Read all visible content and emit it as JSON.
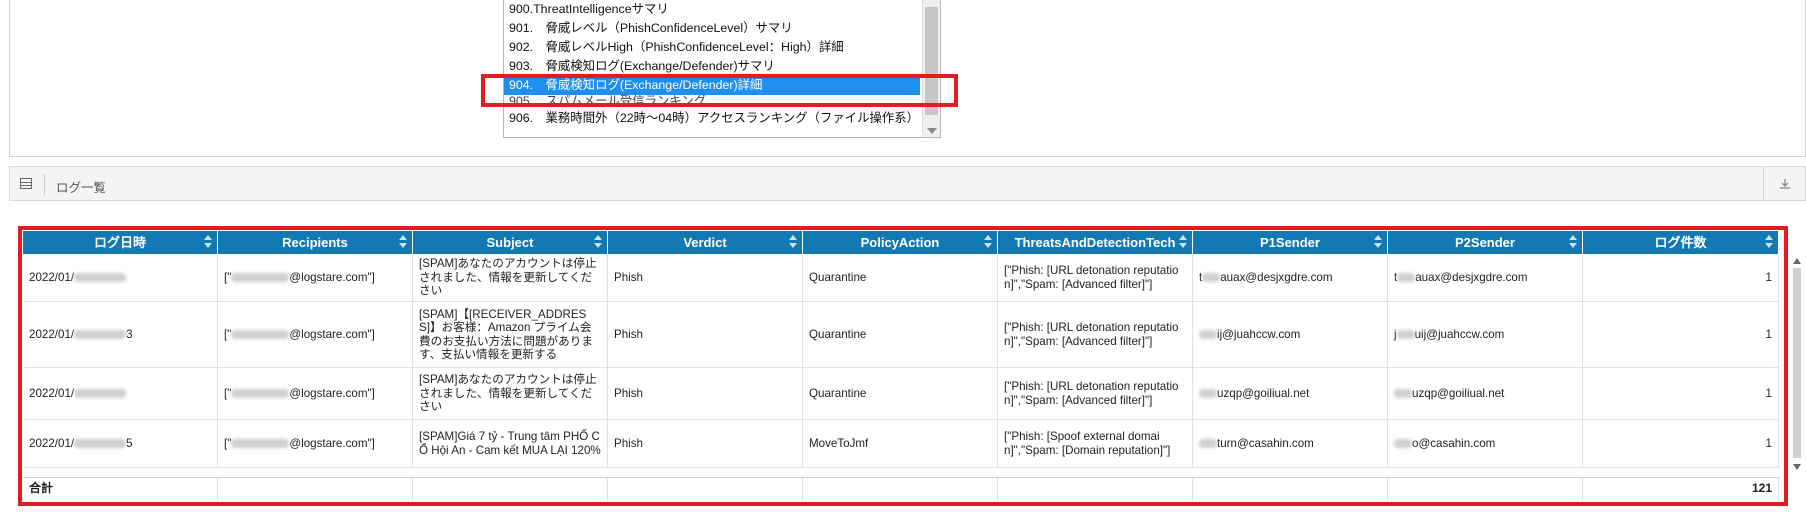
{
  "report_list": {
    "items": [
      {
        "label": "900.ThreatIntelligenceサマリ",
        "selected": false
      },
      {
        "label": "901.　脅威レベル（PhishConfidenceLevel）サマリ",
        "selected": false
      },
      {
        "label": "902.　脅威レベルHigh（PhishConfidenceLevel：High）詳細",
        "selected": false
      },
      {
        "label": "903.　脅威検知ログ(Exchange/Defender)サマリ",
        "selected": false
      },
      {
        "label": "904.　脅威検知ログ(Exchange/Defender)詳細",
        "selected": true
      },
      {
        "label": "905.　スパムメール受信ランキング",
        "selected": false
      },
      {
        "label": "906.　業務時間外（22時～04時）アクセスランキング（ファイル操作系）",
        "selected": false
      }
    ]
  },
  "log_panel": {
    "title": "ログ一覧",
    "download_icon": "download-icon",
    "grid_icon": "grid-icon"
  },
  "table": {
    "columns": [
      "ログ日時",
      "Recipients",
      "Subject",
      "Verdict",
      "PolicyAction",
      "ThreatsAndDetectionTech",
      "P1Sender",
      "P2Sender",
      "ログ件数"
    ],
    "rows": [
      {
        "date_prefix": "2022/01/",
        "date_suffix": "",
        "recip_prefix": "[\"",
        "recip_suffix": "@logstare.com\"]",
        "subject": "[SPAM]あなたのアカウントは停止されました、情報を更新してください",
        "verdict": "Phish",
        "policy": "Quarantine",
        "threats": "[\"Phish: [URL detonation reputation]\",\"Spam: [Advanced filter]\"]",
        "p1_prefix": "t",
        "p1_suffix": "auax@desjxgdre.com",
        "p2_prefix": "t",
        "p2_suffix": "auax@desjxgdre.com",
        "count": "1",
        "height": 48
      },
      {
        "date_prefix": "2022/01/",
        "date_suffix": "3",
        "recip_prefix": "[\"",
        "recip_suffix": "@logstare.com\"]",
        "subject": "[SPAM]【[RECEIVER_ADDRESS]】お客様：Amazon プライム会費のお支払い方法に問題があります、支払い情報を更新する",
        "verdict": "Phish",
        "policy": "Quarantine",
        "threats": "[\"Phish: [URL detonation reputation]\",\"Spam: [Advanced filter]\"]",
        "p1_prefix": "",
        "p1_suffix": "ij@juahccw.com",
        "p2_prefix": "j",
        "p2_suffix": "uij@juahccw.com",
        "count": "1",
        "height": 66
      },
      {
        "date_prefix": "2022/01/",
        "date_suffix": "",
        "recip_prefix": "[\"",
        "recip_suffix": "@logstare.com\"]",
        "subject": "[SPAM]あなたのアカウントは停止されました、情報を更新してください",
        "verdict": "Phish",
        "policy": "Quarantine",
        "threats": "[\"Phish: [URL detonation reputation]\",\"Spam: [Advanced filter]\"]",
        "p1_prefix": "",
        "p1_suffix": "uzqp@goiliual.net",
        "p2_prefix": "",
        "p2_suffix": "uzqp@goiliual.net",
        "count": "1",
        "height": 52
      },
      {
        "date_prefix": "2022/01/",
        "date_suffix": "5",
        "recip_prefix": "[\"",
        "recip_suffix": "@logstare.com\"]",
        "subject": "[SPAM]Giá 7 tỷ - Trung tâm PHỐ CỔ Hội An - Cam kết MUA LẠI 120%",
        "verdict": "Phish",
        "policy": "MoveToJmf",
        "threats": "[\"Phish: [Spoof external domain]\",\"Spam: [Domain reputation]\"]",
        "p1_prefix": "",
        "p1_suffix": "turn@casahin.com",
        "p2_prefix": "",
        "p2_suffix": "o@casahin.com",
        "count": "1",
        "height": 48
      }
    ],
    "footer": {
      "label": "合計",
      "total": "121"
    }
  }
}
